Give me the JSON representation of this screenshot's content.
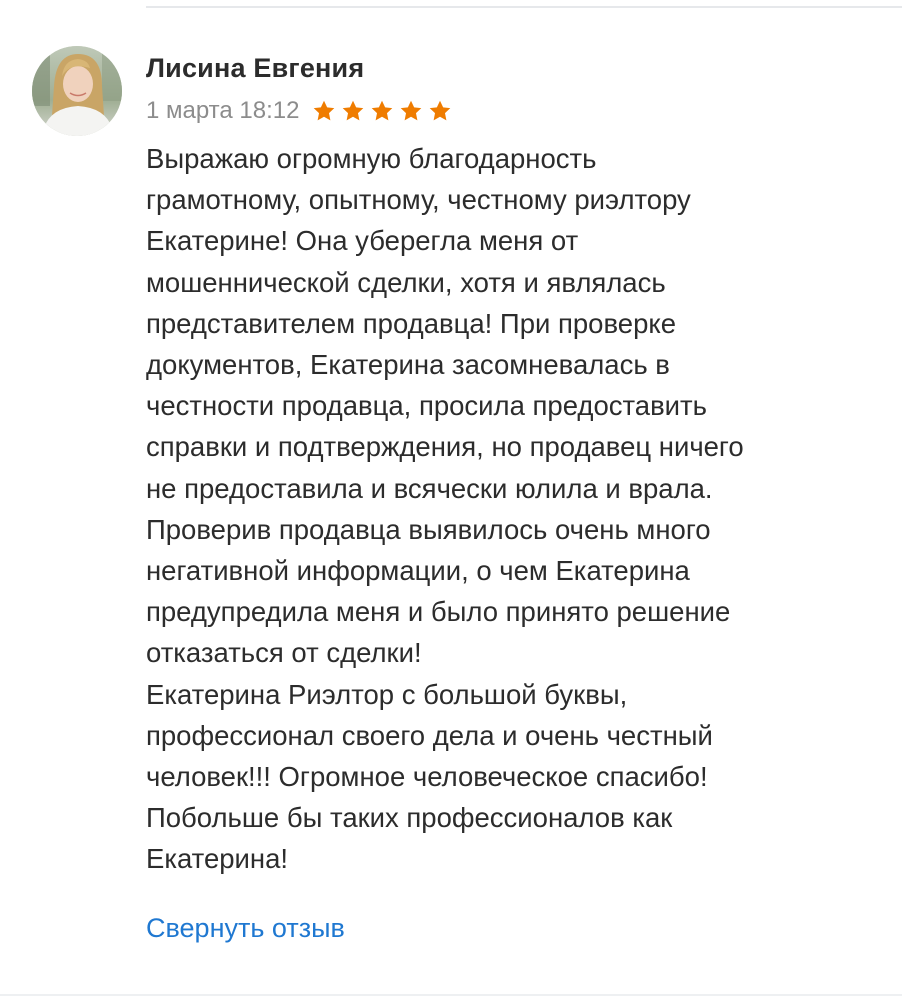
{
  "review": {
    "author": "Лисина Евгения",
    "date": "1 марта 18:12",
    "rating": 5,
    "rating_max": 5,
    "star_color": "#ef7c00",
    "text": "Выражаю огромную благодарность\nграмотному, опытному, честному риэлтору\nЕкатерине! Она уберегла меня от\nмошеннической сделки, хотя и являлась\nпредставителем продавца! При проверке\nдокументов, Екатерина засомневалась в\nчестности продавца, просила предоставить\nсправки и подтверждения, но продавец ничего\nне предоставила и всячески юлила и врала.\nПроверив продавца выявилось очень много\nнегативной информации, о чем Екатерина\nпредупредила меня и было принято решение\nотказаться от сделки!\nЕкатерина Риэлтор с большой буквы,\nпрофессионал своего дела и очень честный\nчеловек!!! Огромное человеческое спасибо!\nПобольше бы таких профессионалов как\nЕкатерина!",
    "collapse_label": "Свернуть отзыв"
  },
  "colors": {
    "link": "#1f78d1",
    "date": "#8c8c8c",
    "text": "#2c2c2c"
  },
  "icons": {
    "star": "star-icon",
    "avatar": "user-avatar-photo"
  }
}
